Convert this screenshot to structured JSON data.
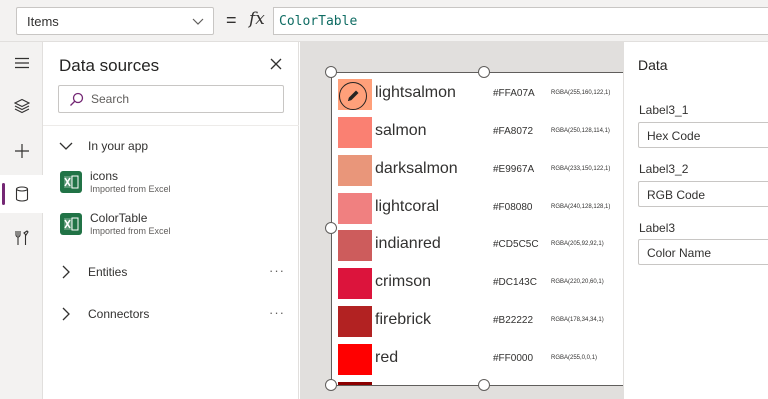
{
  "formula": {
    "property": "Items",
    "equals": "=",
    "fx": "fx",
    "expression": "ColorTable"
  },
  "rail": {
    "items": [
      "menu-icon",
      "layers-icon",
      "plus-icon",
      "database-icon",
      "tools-icon"
    ],
    "active": "database-icon",
    "accent": "#742774"
  },
  "data_sources": {
    "title": "Data sources",
    "search_placeholder": "Search",
    "in_your_app": "In your app",
    "items": [
      {
        "name": "icons",
        "sub": "Imported from Excel"
      },
      {
        "name": "ColorTable",
        "sub": "Imported from Excel"
      }
    ],
    "entities": "Entities",
    "connectors": "Connectors",
    "more": "···"
  },
  "gallery": {
    "rows": [
      {
        "name": "lightsalmon",
        "hex": "#FFA07A",
        "rgba": "RGBA(255,160,122,1)",
        "color": "#FFA07A"
      },
      {
        "name": "salmon",
        "hex": "#FA8072",
        "rgba": "RGBA(250,128,114,1)",
        "color": "#FA8072"
      },
      {
        "name": "darksalmon",
        "hex": "#E9967A",
        "rgba": "RGBA(233,150,122,1)",
        "color": "#E9967A"
      },
      {
        "name": "lightcoral",
        "hex": "#F08080",
        "rgba": "RGBA(240,128,128,1)",
        "color": "#F08080"
      },
      {
        "name": "indianred",
        "hex": "#CD5C5C",
        "rgba": "RGBA(205,92,92,1)",
        "color": "#CD5C5C"
      },
      {
        "name": "crimson",
        "hex": "#DC143C",
        "rgba": "RGBA(220,20,60,1)",
        "color": "#DC143C"
      },
      {
        "name": "firebrick",
        "hex": "#B22222",
        "rgba": "RGBA(178,34,34,1)",
        "color": "#B22222"
      },
      {
        "name": "red",
        "hex": "#FF0000",
        "rgba": "RGBA(255,0,0,1)",
        "color": "#FF0000"
      },
      {
        "name": "",
        "hex": "",
        "rgba": "",
        "color": "#8B0000"
      }
    ]
  },
  "properties": {
    "title": "Data",
    "fields": [
      {
        "label": "Label3_1",
        "value": "Hex Code"
      },
      {
        "label": "Label3_2",
        "value": "RGB Code"
      },
      {
        "label": "Label3",
        "value": "Color Name"
      }
    ]
  }
}
